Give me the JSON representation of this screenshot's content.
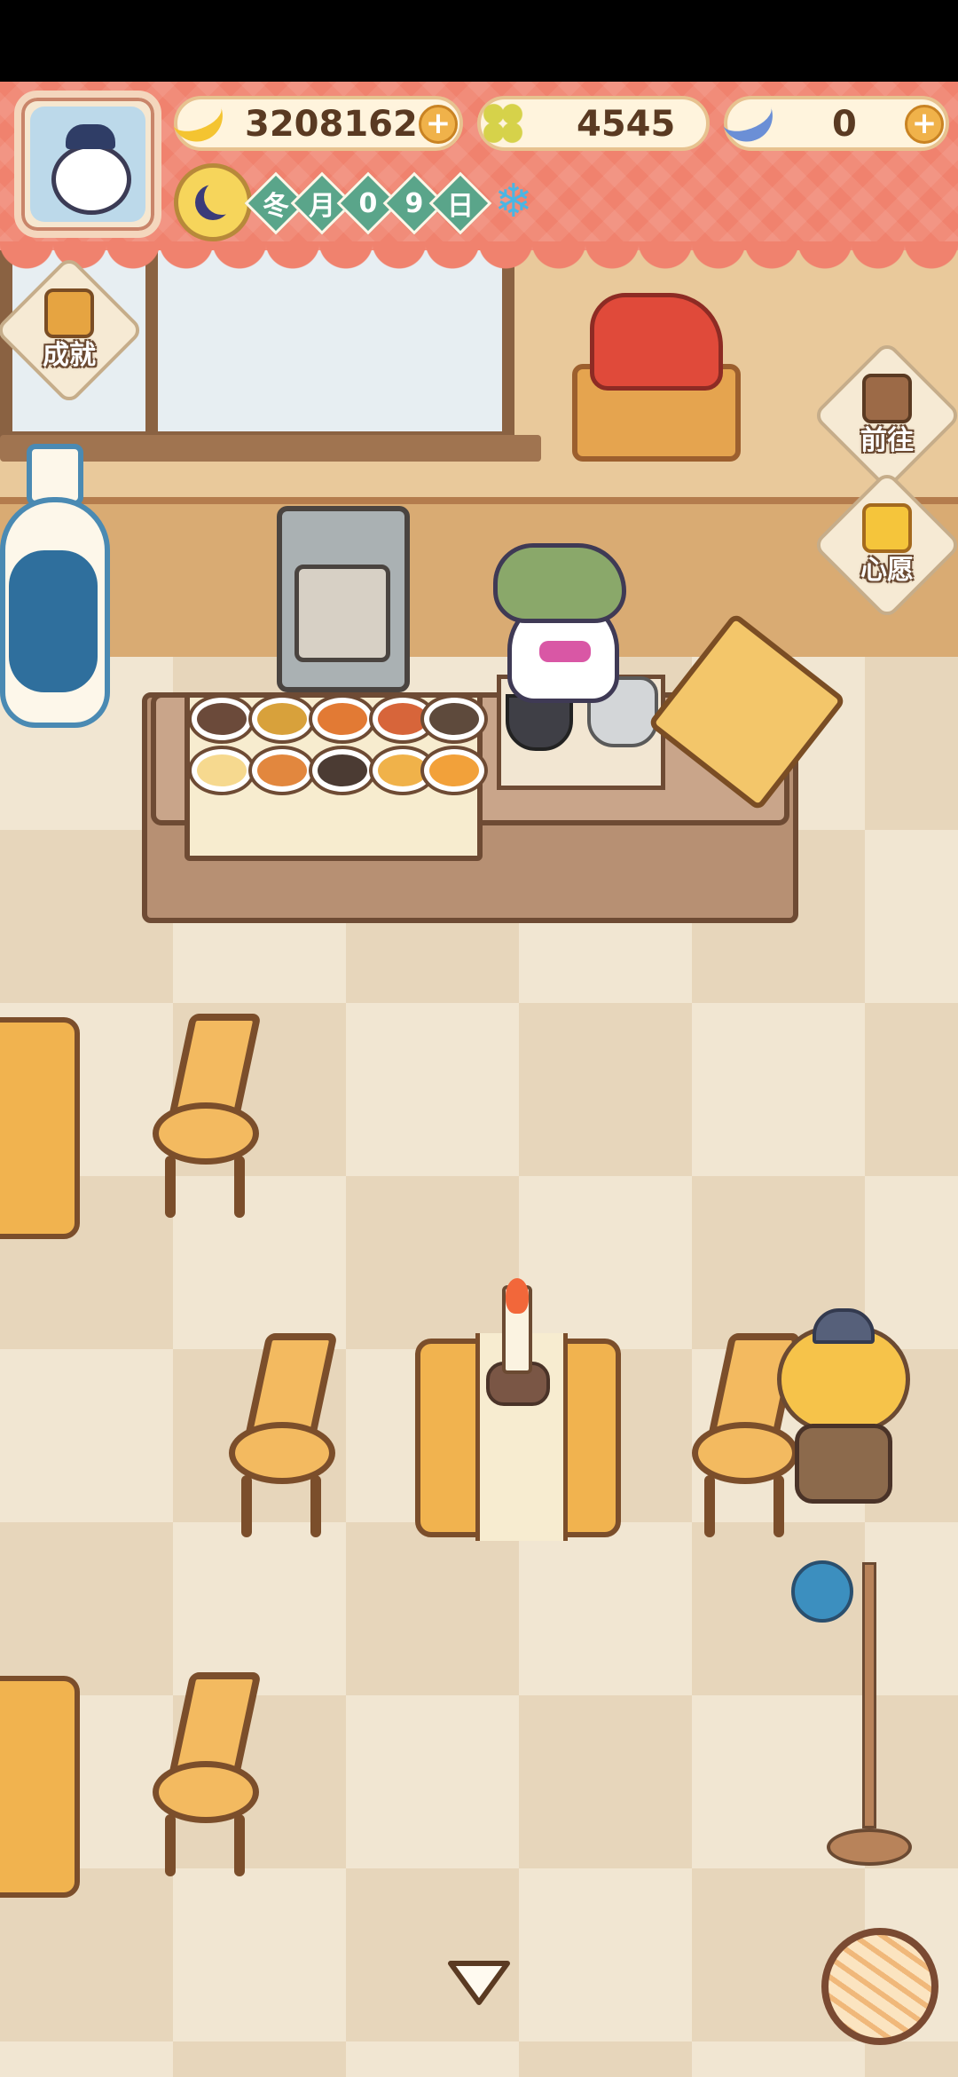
{
  "hud": {
    "avatar_name": "avatar",
    "currencies": [
      {
        "id": "banana",
        "icon": "banana-icon",
        "value": "3208162",
        "has_plus": true
      },
      {
        "id": "clover",
        "icon": "clover-icon",
        "value": "4545",
        "has_plus": false
      },
      {
        "id": "blue_banana",
        "icon": "blue-banana-icon",
        "value": "0",
        "has_plus": true
      }
    ],
    "plus_label": "+",
    "date": {
      "icon": "moon-icon",
      "chars": [
        "冬",
        "月",
        "0",
        "9",
        "日"
      ]
    },
    "weather_icon": "snowflake-icon",
    "weather_glyph": "❄"
  },
  "side_buttons": {
    "achievements": {
      "label": "成就",
      "icon": "clipboard-icon"
    },
    "go": {
      "label": "前往",
      "icon": "signboard-icon"
    },
    "wish": {
      "label": "心愿",
      "icon": "heart-book-icon"
    }
  },
  "bottom": {
    "collapse_icon": "chevron-down-icon",
    "yarn_icon": "yarn-ball-icon"
  },
  "colors": {
    "hud_red": "#f0826e",
    "date_green": "#5aa58a",
    "floor_light": "#f1e6d2",
    "floor_dark": "#e7d6bb",
    "wood": "#f1b34f"
  }
}
